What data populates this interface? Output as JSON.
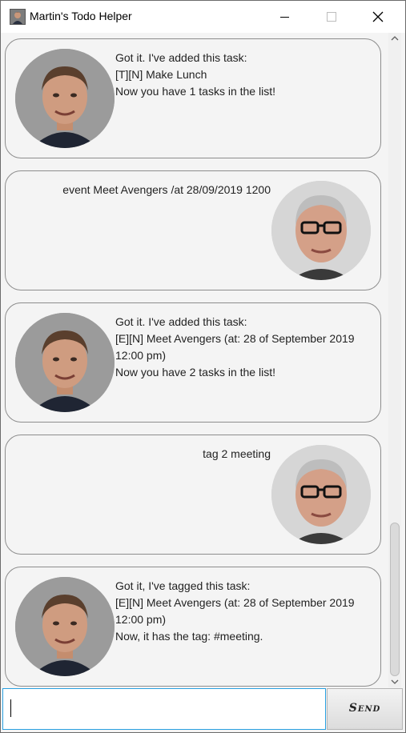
{
  "window": {
    "title": "Martin's Todo Helper",
    "icon": "app-avatar-icon"
  },
  "messages": [
    {
      "sender": "bot",
      "text": "Got it. I've added this task:\n[T][N] Make Lunch\nNow you have 1 tasks in the list!"
    },
    {
      "sender": "user",
      "text": "event Meet Avengers /at 28/09/2019 1200"
    },
    {
      "sender": "bot",
      "text": "Got it. I've added this task:\n[E][N] Meet Avengers (at: 28 of September 2019\n12:00 pm)\nNow you have 2 tasks in the list!"
    },
    {
      "sender": "user",
      "text": "tag 2 meeting"
    },
    {
      "sender": "bot",
      "text": "Got it, I've tagged this task:\n[E][N] Meet Avengers (at: 28 of September 2019\n12:00 pm)\nNow, it has the tag: #meeting."
    }
  ],
  "input": {
    "value": "",
    "placeholder": ""
  },
  "send_button": {
    "label": "Send"
  }
}
